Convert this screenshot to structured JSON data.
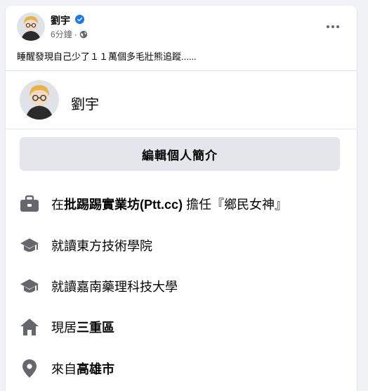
{
  "post": {
    "author": "劉宇",
    "time": "6分鐘",
    "separator": "·",
    "text": "睡醒發現自己少了１１萬個多毛壯熊追蹤......"
  },
  "profile": {
    "name": "劉宇",
    "edit_button": "編輯個人簡介",
    "info": [
      {
        "icon": "briefcase-icon",
        "prefix": "在",
        "bold": "批踢踢實業坊(Ptt.cc)",
        "suffix": " 擔任『鄉民女神』"
      },
      {
        "icon": "graduation-cap-icon",
        "prefix": "就讀東方技術學院",
        "bold": "",
        "suffix": ""
      },
      {
        "icon": "graduation-cap-icon",
        "prefix": "就讀嘉南藥理科技大學",
        "bold": "",
        "suffix": ""
      },
      {
        "icon": "home-icon",
        "prefix": "現居",
        "bold": "三重區",
        "suffix": ""
      },
      {
        "icon": "location-pin-icon",
        "prefix": "來自",
        "bold": "高雄市",
        "suffix": ""
      }
    ]
  },
  "colors": {
    "verified": "#1877f2",
    "icon": "#65676b",
    "button_bg": "#e4e6eb"
  }
}
